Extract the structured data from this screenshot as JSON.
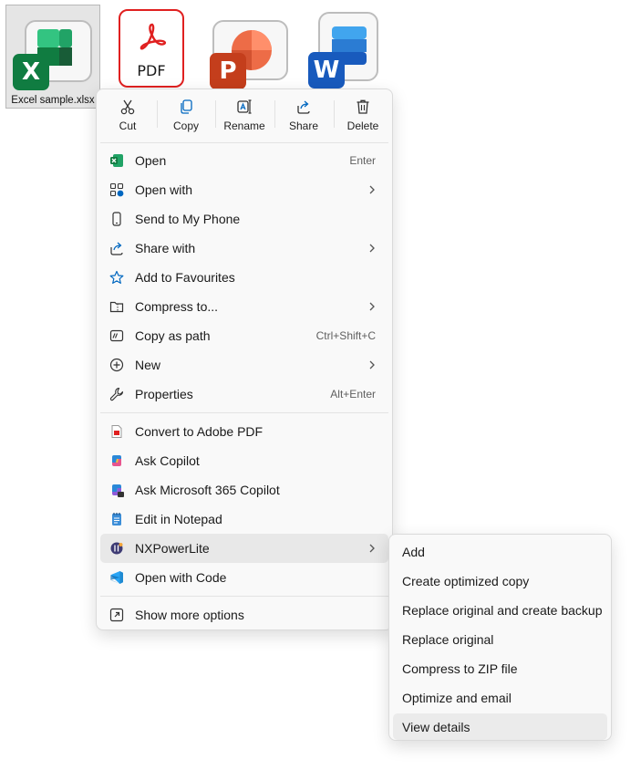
{
  "desktop": {
    "files": [
      {
        "label": "Excel sample.xlsx",
        "icon": "excel-file-icon",
        "badge": "X",
        "color": "#107c41"
      },
      {
        "label": "",
        "icon": "pdf-file-icon",
        "badge": "PDF",
        "color": "#e02020"
      },
      {
        "label": "",
        "icon": "powerpoint-file-icon",
        "badge": "P",
        "color": "#c43e1c"
      },
      {
        "label": "",
        "icon": "word-file-icon",
        "badge": "W",
        "color": "#185abd"
      }
    ]
  },
  "toolbar": {
    "cut": "Cut",
    "copy": "Copy",
    "rename": "Rename",
    "share": "Share",
    "delete": "Delete"
  },
  "menu": {
    "items": [
      {
        "label": "Open",
        "shortcut": "Enter",
        "icon": "excel-app-icon"
      },
      {
        "label": "Open with",
        "shortcut": "",
        "icon": "open-with-icon"
      },
      {
        "label": "Send to My Phone",
        "shortcut": "",
        "icon": "phone-icon"
      },
      {
        "label": "Share with",
        "shortcut": "",
        "icon": "share-with-icon"
      },
      {
        "label": "Add to Favourites",
        "shortcut": "",
        "icon": "star-icon"
      },
      {
        "label": "Compress to...",
        "shortcut": "",
        "icon": "zip-folder-icon"
      },
      {
        "label": "Copy as path",
        "shortcut": "Ctrl+Shift+C",
        "icon": "path-icon"
      },
      {
        "label": "New",
        "shortcut": "",
        "icon": "plus-circle-icon"
      },
      {
        "label": "Properties",
        "shortcut": "Alt+Enter",
        "icon": "wrench-icon"
      },
      {
        "label": "Convert to Adobe PDF",
        "shortcut": "",
        "icon": "adobe-pdf-icon"
      },
      {
        "label": "Ask Copilot",
        "shortcut": "",
        "icon": "copilot-icon"
      },
      {
        "label": "Ask Microsoft 365 Copilot",
        "shortcut": "",
        "icon": "m365-copilot-icon"
      },
      {
        "label": "Edit in Notepad",
        "shortcut": "",
        "icon": "notepad-icon"
      },
      {
        "label": "NXPowerLite",
        "shortcut": "",
        "icon": "nxpowerlite-icon"
      },
      {
        "label": "Open with Code",
        "shortcut": "",
        "icon": "vscode-icon"
      },
      {
        "label": "Show more options",
        "shortcut": "",
        "icon": "more-options-icon"
      }
    ]
  },
  "submenu": {
    "items": [
      {
        "label": "Add"
      },
      {
        "label": "Create optimized copy"
      },
      {
        "label": "Replace original and create backup"
      },
      {
        "label": "Replace original"
      },
      {
        "label": "Compress to ZIP file"
      },
      {
        "label": "Optimize and email"
      },
      {
        "label": "View details"
      }
    ]
  },
  "colors": {
    "menu_bg": "#f9f9f9",
    "highlight": "#e8e8e8",
    "excel_green": "#107c41",
    "pdf_red": "#e02020",
    "vscode_blue": "#1f8ad2",
    "accent_blue": "#0067c0"
  }
}
